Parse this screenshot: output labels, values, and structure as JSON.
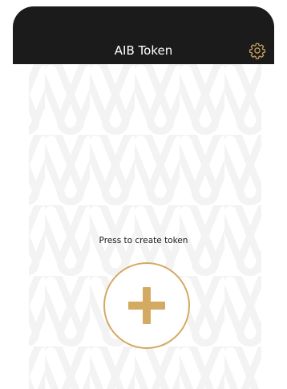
{
  "app": {
    "title": "AIB Token"
  },
  "header": {
    "title": "AIB Token",
    "settings_icon": "gear-icon"
  },
  "main": {
    "prompt": "Press to create token",
    "create_button_icon": "plus-icon",
    "background_pattern": "interlocking-loops-watermark"
  },
  "colors": {
    "header_bg": "#1b1b1b",
    "header_text": "#ffffff",
    "accent_gold": "#d4aa62",
    "page_bg": "#ffffff",
    "pattern": "#f4f4f4"
  }
}
